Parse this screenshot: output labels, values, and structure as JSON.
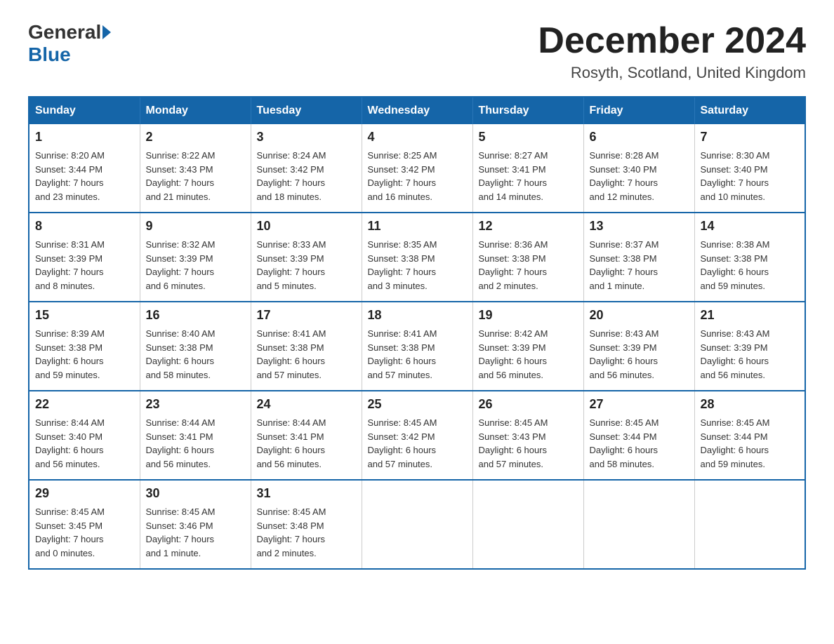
{
  "header": {
    "logo_general": "General",
    "logo_blue": "Blue",
    "month_title": "December 2024",
    "location": "Rosyth, Scotland, United Kingdom"
  },
  "days_of_week": [
    "Sunday",
    "Monday",
    "Tuesday",
    "Wednesday",
    "Thursday",
    "Friday",
    "Saturday"
  ],
  "weeks": [
    [
      {
        "day": "1",
        "sunrise": "8:20 AM",
        "sunset": "3:44 PM",
        "daylight": "7 hours and 23 minutes."
      },
      {
        "day": "2",
        "sunrise": "8:22 AM",
        "sunset": "3:43 PM",
        "daylight": "7 hours and 21 minutes."
      },
      {
        "day": "3",
        "sunrise": "8:24 AM",
        "sunset": "3:42 PM",
        "daylight": "7 hours and 18 minutes."
      },
      {
        "day": "4",
        "sunrise": "8:25 AM",
        "sunset": "3:42 PM",
        "daylight": "7 hours and 16 minutes."
      },
      {
        "day": "5",
        "sunrise": "8:27 AM",
        "sunset": "3:41 PM",
        "daylight": "7 hours and 14 minutes."
      },
      {
        "day": "6",
        "sunrise": "8:28 AM",
        "sunset": "3:40 PM",
        "daylight": "7 hours and 12 minutes."
      },
      {
        "day": "7",
        "sunrise": "8:30 AM",
        "sunset": "3:40 PM",
        "daylight": "7 hours and 10 minutes."
      }
    ],
    [
      {
        "day": "8",
        "sunrise": "8:31 AM",
        "sunset": "3:39 PM",
        "daylight": "7 hours and 8 minutes."
      },
      {
        "day": "9",
        "sunrise": "8:32 AM",
        "sunset": "3:39 PM",
        "daylight": "7 hours and 6 minutes."
      },
      {
        "day": "10",
        "sunrise": "8:33 AM",
        "sunset": "3:39 PM",
        "daylight": "7 hours and 5 minutes."
      },
      {
        "day": "11",
        "sunrise": "8:35 AM",
        "sunset": "3:38 PM",
        "daylight": "7 hours and 3 minutes."
      },
      {
        "day": "12",
        "sunrise": "8:36 AM",
        "sunset": "3:38 PM",
        "daylight": "7 hours and 2 minutes."
      },
      {
        "day": "13",
        "sunrise": "8:37 AM",
        "sunset": "3:38 PM",
        "daylight": "7 hours and 1 minute."
      },
      {
        "day": "14",
        "sunrise": "8:38 AM",
        "sunset": "3:38 PM",
        "daylight": "6 hours and 59 minutes."
      }
    ],
    [
      {
        "day": "15",
        "sunrise": "8:39 AM",
        "sunset": "3:38 PM",
        "daylight": "6 hours and 59 minutes."
      },
      {
        "day": "16",
        "sunrise": "8:40 AM",
        "sunset": "3:38 PM",
        "daylight": "6 hours and 58 minutes."
      },
      {
        "day": "17",
        "sunrise": "8:41 AM",
        "sunset": "3:38 PM",
        "daylight": "6 hours and 57 minutes."
      },
      {
        "day": "18",
        "sunrise": "8:41 AM",
        "sunset": "3:38 PM",
        "daylight": "6 hours and 57 minutes."
      },
      {
        "day": "19",
        "sunrise": "8:42 AM",
        "sunset": "3:39 PM",
        "daylight": "6 hours and 56 minutes."
      },
      {
        "day": "20",
        "sunrise": "8:43 AM",
        "sunset": "3:39 PM",
        "daylight": "6 hours and 56 minutes."
      },
      {
        "day": "21",
        "sunrise": "8:43 AM",
        "sunset": "3:39 PM",
        "daylight": "6 hours and 56 minutes."
      }
    ],
    [
      {
        "day": "22",
        "sunrise": "8:44 AM",
        "sunset": "3:40 PM",
        "daylight": "6 hours and 56 minutes."
      },
      {
        "day": "23",
        "sunrise": "8:44 AM",
        "sunset": "3:41 PM",
        "daylight": "6 hours and 56 minutes."
      },
      {
        "day": "24",
        "sunrise": "8:44 AM",
        "sunset": "3:41 PM",
        "daylight": "6 hours and 56 minutes."
      },
      {
        "day": "25",
        "sunrise": "8:45 AM",
        "sunset": "3:42 PM",
        "daylight": "6 hours and 57 minutes."
      },
      {
        "day": "26",
        "sunrise": "8:45 AM",
        "sunset": "3:43 PM",
        "daylight": "6 hours and 57 minutes."
      },
      {
        "day": "27",
        "sunrise": "8:45 AM",
        "sunset": "3:44 PM",
        "daylight": "6 hours and 58 minutes."
      },
      {
        "day": "28",
        "sunrise": "8:45 AM",
        "sunset": "3:44 PM",
        "daylight": "6 hours and 59 minutes."
      }
    ],
    [
      {
        "day": "29",
        "sunrise": "8:45 AM",
        "sunset": "3:45 PM",
        "daylight": "7 hours and 0 minutes."
      },
      {
        "day": "30",
        "sunrise": "8:45 AM",
        "sunset": "3:46 PM",
        "daylight": "7 hours and 1 minute."
      },
      {
        "day": "31",
        "sunrise": "8:45 AM",
        "sunset": "3:48 PM",
        "daylight": "7 hours and 2 minutes."
      },
      null,
      null,
      null,
      null
    ]
  ],
  "labels": {
    "sunrise": "Sunrise:",
    "sunset": "Sunset:",
    "daylight": "Daylight:"
  }
}
